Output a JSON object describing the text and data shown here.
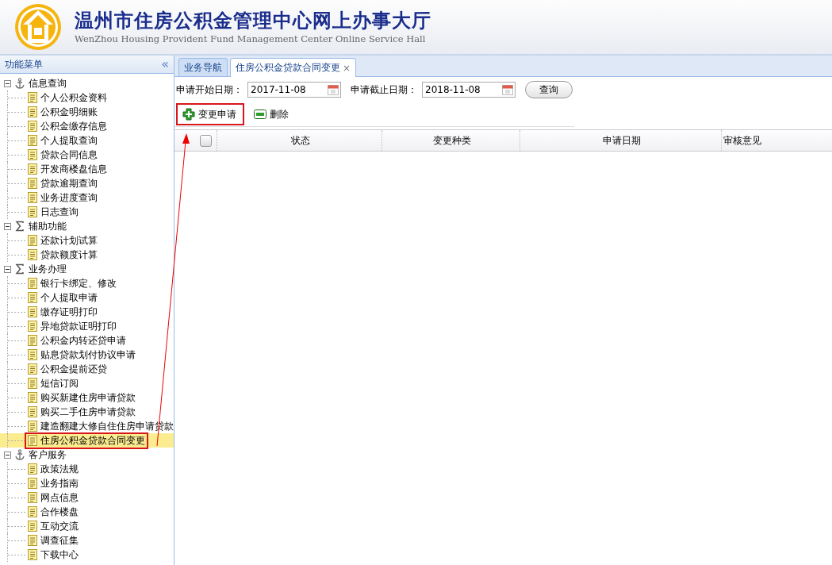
{
  "header": {
    "title": "温州市住房公积金管理中心网上办事大厅",
    "subtitle": "WenZhou Housing Provident Fund Management Center Online Service Hall"
  },
  "sidebar": {
    "title": "功能菜单",
    "collapse": "«",
    "tree": [
      {
        "label": "信息查询",
        "kind": "anchor",
        "expanded": true,
        "children": [
          {
            "label": "个人公积金资料",
            "selected": false,
            "annotated": false
          },
          {
            "label": "公积金明细账",
            "selected": false,
            "annotated": false
          },
          {
            "label": "公积金缴存信息",
            "selected": false,
            "annotated": false
          },
          {
            "label": "个人提取查询",
            "selected": false,
            "annotated": false
          },
          {
            "label": "贷款合同信息",
            "selected": false,
            "annotated": false
          },
          {
            "label": "开发商楼盘信息",
            "selected": false,
            "annotated": false
          },
          {
            "label": "贷款逾期查询",
            "selected": false,
            "annotated": false
          },
          {
            "label": "业务进度查询",
            "selected": false,
            "annotated": false
          },
          {
            "label": "日志查询",
            "selected": false,
            "annotated": false
          }
        ]
      },
      {
        "label": "辅助功能",
        "kind": "sigma",
        "expanded": true,
        "children": [
          {
            "label": "还款计划试算",
            "selected": false,
            "annotated": false
          },
          {
            "label": "贷款额度计算",
            "selected": false,
            "annotated": false
          }
        ]
      },
      {
        "label": "业务办理",
        "kind": "sigma",
        "expanded": true,
        "children": [
          {
            "label": "银行卡绑定、修改",
            "selected": false,
            "annotated": false
          },
          {
            "label": "个人提取申请",
            "selected": false,
            "annotated": false
          },
          {
            "label": "缴存证明打印",
            "selected": false,
            "annotated": false
          },
          {
            "label": "异地贷款证明打印",
            "selected": false,
            "annotated": false
          },
          {
            "label": "公积金内转还贷申请",
            "selected": false,
            "annotated": false
          },
          {
            "label": "贴息贷款划付协议申请",
            "selected": false,
            "annotated": false
          },
          {
            "label": "公积金提前还贷",
            "selected": false,
            "annotated": false
          },
          {
            "label": "短信订阅",
            "selected": false,
            "annotated": false
          },
          {
            "label": "购买新建住房申请贷款",
            "selected": false,
            "annotated": false
          },
          {
            "label": "购买二手住房申请贷款",
            "selected": false,
            "annotated": false
          },
          {
            "label": "建造翻建大修自住住房申请贷款",
            "selected": false,
            "annotated": false
          },
          {
            "label": "住房公积金贷款合同变更",
            "selected": true,
            "annotated": true
          }
        ]
      },
      {
        "label": "客户服务",
        "kind": "anchor",
        "expanded": true,
        "children": [
          {
            "label": "政策法规",
            "selected": false,
            "annotated": false
          },
          {
            "label": "业务指南",
            "selected": false,
            "annotated": false
          },
          {
            "label": "网点信息",
            "selected": false,
            "annotated": false
          },
          {
            "label": "合作楼盘",
            "selected": false,
            "annotated": false
          },
          {
            "label": "互动交流",
            "selected": false,
            "annotated": false
          },
          {
            "label": "调查征集",
            "selected": false,
            "annotated": false
          },
          {
            "label": "下载中心",
            "selected": false,
            "annotated": false
          }
        ]
      }
    ]
  },
  "tabs": [
    {
      "label": "业务导航",
      "selected": false
    },
    {
      "label": "住房公积金贷款合同变更",
      "selected": true,
      "close": "×"
    }
  ],
  "filters": [
    {
      "label": "申请开始日期：",
      "value": "2017-11-08"
    },
    {
      "label": "申请截止日期：",
      "value": "2018-11-08"
    }
  ],
  "query_button": "查询",
  "toolbar": [
    {
      "label": "变更申请",
      "kind": "add",
      "annotated": true
    },
    {
      "label": "删除",
      "kind": "remove",
      "annotated": false
    }
  ],
  "table": {
    "select_all_checked": false,
    "columns": [
      "状态",
      "变更种类",
      "申请日期",
      "审核意见"
    ]
  }
}
